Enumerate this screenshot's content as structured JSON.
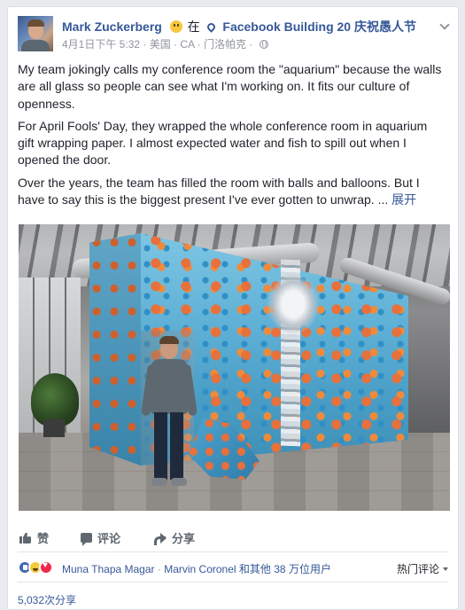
{
  "post": {
    "author": "Mark Zuckerberg",
    "feeling_icon": "party-face",
    "at_text": "在",
    "location": "Facebook Building 20",
    "event": "庆祝愚人节",
    "timestamp": "4月1日下午 5:32",
    "region": "美国 · CA · 门洛帕克 ·",
    "privacy_icon": "globe",
    "paragraphs": [
      "My team jokingly calls my conference room the \"aquarium\" because the walls are all glass so people can see what I'm working on. It fits our culture of openness.",
      "For April Fools' Day, they wrapped the whole conference room in aquarium gift wrapping paper. I almost expected water and fish to spill out when I opened the door.",
      "Over the years, the team has filled the room with balls and balloons. But I have to say this is the biggest present I've ever gotten to unwrap. ..."
    ],
    "see_more": "展开"
  },
  "actions": {
    "like": "赞",
    "comment": "评论",
    "share": "分享"
  },
  "reactions": {
    "icons": [
      "like",
      "haha",
      "love"
    ],
    "name1": "Muna Thapa Magar",
    "separator": "·",
    "name2": "Marvin Coronel",
    "others": "和其他 38 万位用户",
    "sort": "热门评论"
  },
  "shares": "5,032次分享",
  "colors": {
    "link": "#365899",
    "meta": "#90949c",
    "action": "#606770",
    "background": "#e9ebee"
  }
}
